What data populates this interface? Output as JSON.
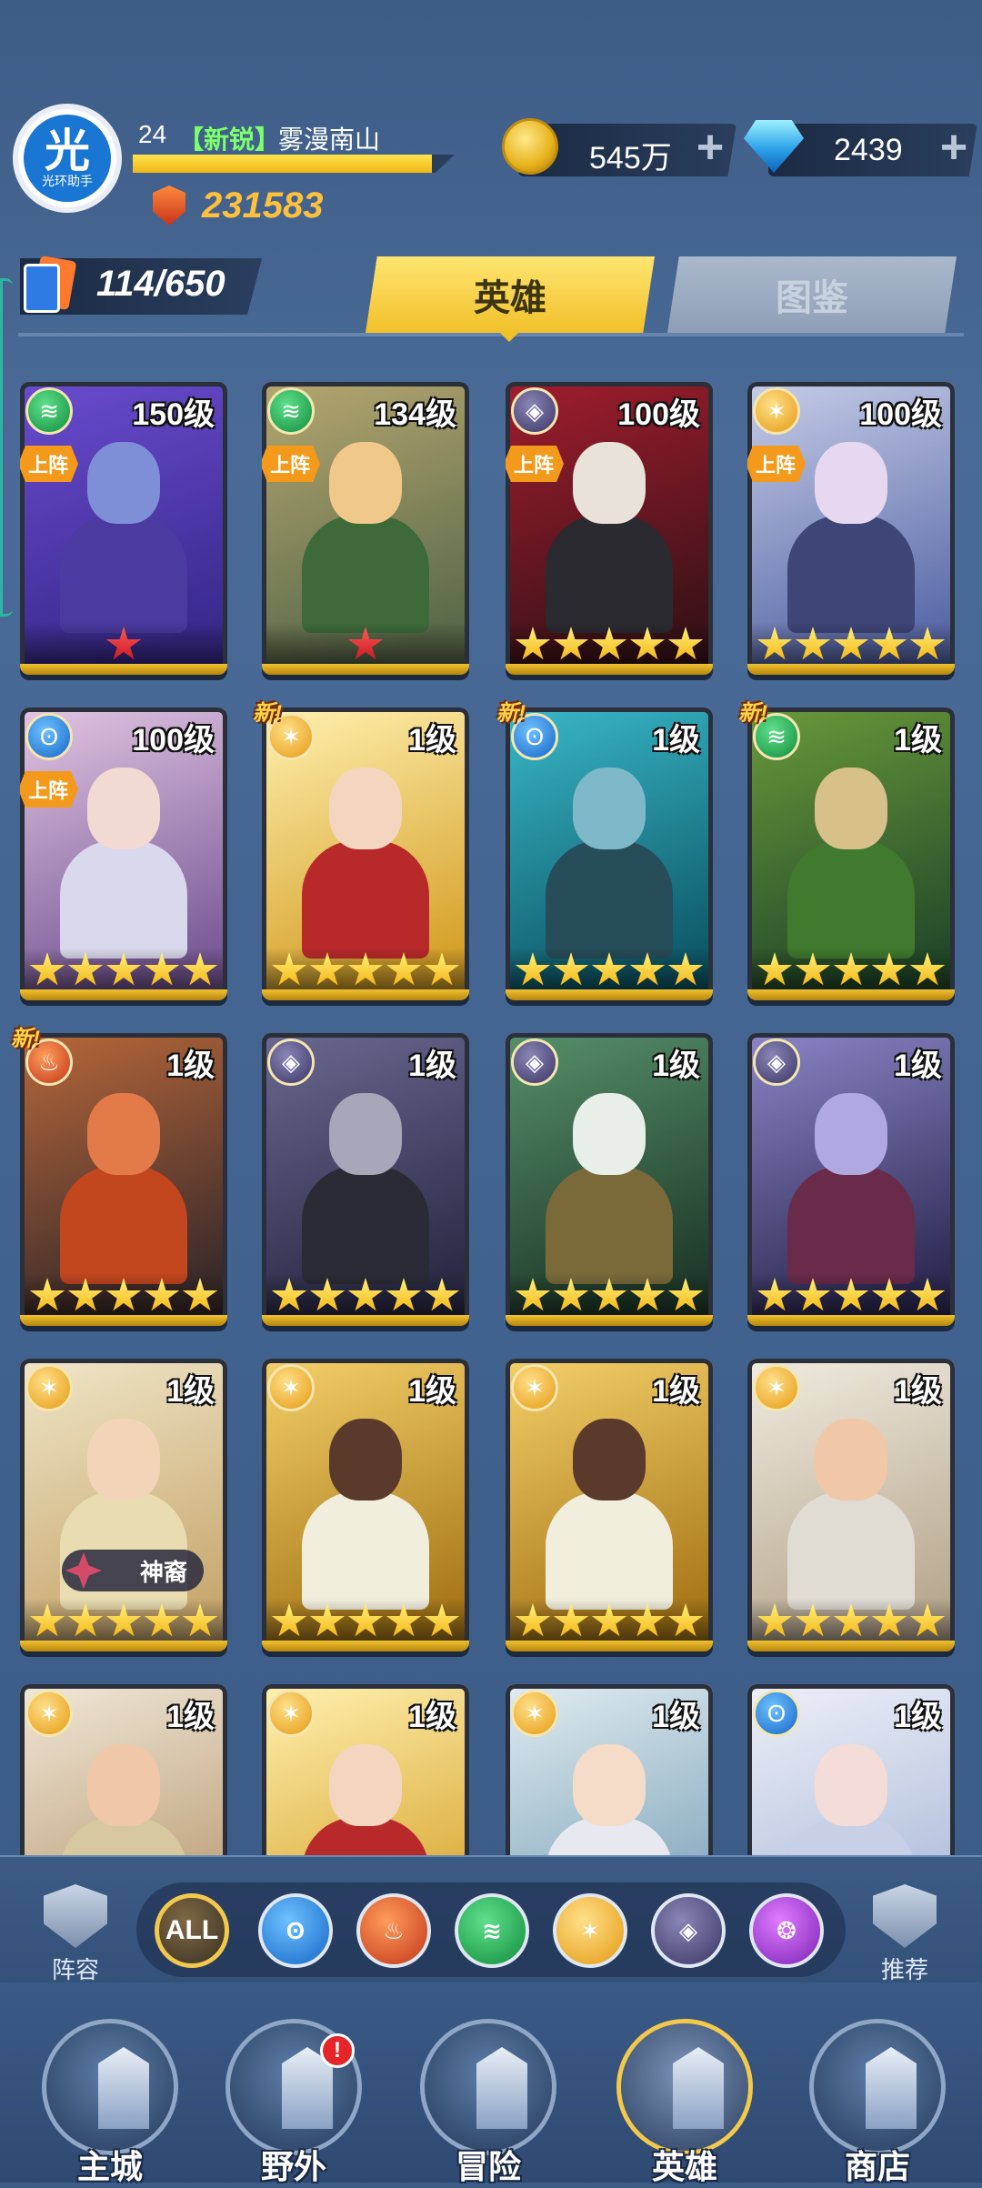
{
  "player": {
    "avatar_big": "光",
    "avatar_small": "光环助手",
    "level": "24",
    "rank_tag": "【新锐】",
    "name": "雾漫南山",
    "xp_fraction": 0.93,
    "power": "231583"
  },
  "resources": {
    "coins": "545万",
    "gems": "2439",
    "plus": "+"
  },
  "collection": {
    "count": "114/650"
  },
  "tabs": {
    "heroes": "英雄",
    "codex": "图鉴"
  },
  "cards": [
    {
      "level": "150级",
      "faction": "wind",
      "faction_glyph": "≋",
      "deployed": "上阵",
      "stars": 1,
      "star_color": "red",
      "palette": [
        "#3a2a8e",
        "#6a4ccf"
      ],
      "skin": "#7e8fd8",
      "cloth": "#4b3aa0"
    },
    {
      "level": "134级",
      "faction": "wind",
      "faction_glyph": "≋",
      "deployed": "上阵",
      "stars": 1,
      "star_color": "red",
      "palette": [
        "#5a6a4a",
        "#b6a770"
      ],
      "skin": "#f0c88a",
      "cloth": "#3e6a3a"
    },
    {
      "level": "100级",
      "faction": "dark",
      "faction_glyph": "◈",
      "deployed": "上阵",
      "stars": 5,
      "star_color": "gold",
      "palette": [
        "#3a1218",
        "#a21d2e"
      ],
      "skin": "#e9e2d8",
      "cloth": "#2a2a30"
    },
    {
      "level": "100级",
      "faction": "light",
      "faction_glyph": "✶",
      "deployed": "上阵",
      "stars": 5,
      "star_color": "gold",
      "palette": [
        "#5a6aa8",
        "#c7cde8"
      ],
      "skin": "#e6d8f0",
      "cloth": "#3e4678"
    },
    {
      "level": "100级",
      "faction": "water",
      "faction_glyph": "ʘ",
      "deployed": "上阵",
      "stars": 5,
      "star_color": "gold",
      "palette": [
        "#7a5a98",
        "#e2c6e2"
      ],
      "skin": "#f2d9d2",
      "cloth": "#dad8ec"
    },
    {
      "level": "1级",
      "faction": "light",
      "faction_glyph": "✶",
      "new": "新!",
      "stars": 5,
      "star_color": "gold",
      "palette": [
        "#d6a12a",
        "#fff1b0"
      ],
      "skin": "#f4d6c0",
      "cloth": "#b82a2a"
    },
    {
      "level": "1级",
      "faction": "water",
      "faction_glyph": "ʘ",
      "new": "新!",
      "stars": 5,
      "star_color": "gold",
      "palette": [
        "#0e5a6a",
        "#39b8c8"
      ],
      "skin": "#7fb8c8",
      "cloth": "#274c5a"
    },
    {
      "level": "1级",
      "faction": "wind",
      "faction_glyph": "≋",
      "new": "新!",
      "stars": 5,
      "star_color": "gold",
      "palette": [
        "#234a2a",
        "#6a9a3a"
      ],
      "skin": "#d8c08a",
      "cloth": "#3f7a2e"
    },
    {
      "level": "1级",
      "faction": "fire",
      "faction_glyph": "♨",
      "new": "新!",
      "stars": 5,
      "star_color": "gold",
      "palette": [
        "#3a2a2a",
        "#b8683a"
      ],
      "skin": "#e27a4a",
      "cloth": "#c2461e"
    },
    {
      "level": "1级",
      "faction": "dark",
      "faction_glyph": "◈",
      "stars": 5,
      "star_color": "gold",
      "palette": [
        "#2a2a46",
        "#6a6890"
      ],
      "skin": "#a4a8b8",
      "cloth": "#2b2b36"
    },
    {
      "level": "1级",
      "faction": "dark",
      "faction_glyph": "◈",
      "stars": 5,
      "star_color": "gold",
      "palette": [
        "#1f3a2a",
        "#56906a"
      ],
      "skin": "#e8eee8",
      "cloth": "#7a6a3a"
    },
    {
      "level": "1级",
      "faction": "dark",
      "faction_glyph": "◈",
      "stars": 5,
      "star_color": "gold",
      "palette": [
        "#2e2a54",
        "#8a86c8"
      ],
      "skin": "#b0a8e0",
      "cloth": "#6a2a4a"
    },
    {
      "level": "1级",
      "faction": "light",
      "faction_glyph": "✶",
      "stars": 5,
      "star_color": "gold",
      "palette": [
        "#c8a870",
        "#f0e6c8"
      ],
      "skin": "#f2d4b8",
      "cloth": "#e8dcb0",
      "shenyi": "神裔"
    },
    {
      "level": "1级",
      "faction": "light",
      "faction_glyph": "✶",
      "stars": 5,
      "star_color": "gold",
      "palette": [
        "#a8781a",
        "#f4d06a"
      ],
      "skin": "#5a3a2a",
      "cloth": "#f2eede"
    },
    {
      "level": "1级",
      "faction": "light",
      "faction_glyph": "✶",
      "stars": 5,
      "star_color": "gold",
      "palette": [
        "#a8781a",
        "#f4d06a"
      ],
      "skin": "#5a3a2a",
      "cloth": "#f2eede"
    },
    {
      "level": "1级",
      "faction": "light",
      "faction_glyph": "✶",
      "stars": 5,
      "star_color": "gold",
      "palette": [
        "#b8a890",
        "#f0ece0"
      ],
      "skin": "#f0c8a8",
      "cloth": "#e0dcd4"
    },
    {
      "level": "1级",
      "faction": "light",
      "faction_glyph": "✶",
      "stars": 0,
      "star_color": "gold",
      "palette": [
        "#b89870",
        "#f0e8d8"
      ],
      "skin": "#f0c8a8",
      "cloth": "#d8c8a0"
    },
    {
      "level": "1级",
      "faction": "light",
      "faction_glyph": "✶",
      "stars": 0,
      "star_color": "gold",
      "palette": [
        "#d6a12a",
        "#fff1b0"
      ],
      "skin": "#f4d6c0",
      "cloth": "#b82a2a"
    },
    {
      "level": "1级",
      "faction": "light",
      "faction_glyph": "✶",
      "stars": 0,
      "star_color": "gold",
      "palette": [
        "#7aa0b8",
        "#e0ecf0"
      ],
      "skin": "#f4dcc8",
      "cloth": "#e8e8f0"
    },
    {
      "level": "1级",
      "faction": "water",
      "faction_glyph": "ʘ",
      "stars": 0,
      "star_color": "gold",
      "palette": [
        "#a8b8d8",
        "#eef0f8"
      ],
      "skin": "#f4dcd8",
      "cloth": "#c8d0e8"
    }
  ],
  "filters": {
    "lineup": "阵容",
    "recommend": "推荐",
    "all": "ALL",
    "chips": [
      "water",
      "fire",
      "wind",
      "light",
      "dark",
      "chaos"
    ],
    "glyphs": [
      "ʘ",
      "♨",
      "≋",
      "✶",
      "◈",
      "❂"
    ]
  },
  "nav": {
    "items": [
      {
        "label": "主城",
        "icon": "castle-icon"
      },
      {
        "label": "野外",
        "icon": "portal-icon",
        "badge": "!"
      },
      {
        "label": "冒险",
        "icon": "sword-icon"
      },
      {
        "label": "英雄",
        "icon": "knight-helmet-icon",
        "active": true
      },
      {
        "label": "商店",
        "icon": "shop-icon"
      }
    ]
  }
}
